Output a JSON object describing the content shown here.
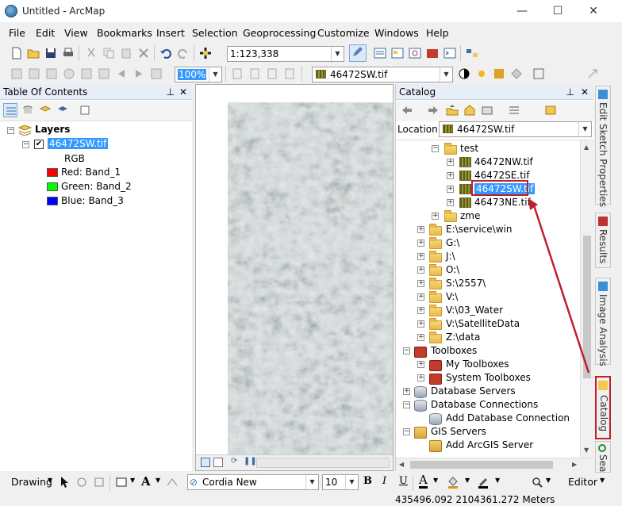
{
  "window": {
    "title": "Untitled - ArcMap",
    "minimize": "—",
    "maximize": "☐",
    "close": "✕"
  },
  "menubar": [
    "File",
    "Edit",
    "View",
    "Bookmarks",
    "Insert",
    "Selection",
    "Geoprocessing",
    "Customize",
    "Windows",
    "Help"
  ],
  "toolbar": {
    "scale": "1:123,338",
    "zoom": "100%",
    "layer_select": "46472SW.tif"
  },
  "toc": {
    "title": "Table Of Contents",
    "layers_label": "Layers",
    "layer_name": "46472SW.tif",
    "rgb_label": "RGB",
    "bands": [
      {
        "label": "Red:",
        "band": "Band_1",
        "color": "#ff0000"
      },
      {
        "label": "Green:",
        "band": "Band_2",
        "color": "#00ff00"
      },
      {
        "label": "Blue:",
        "band": "Band_3",
        "color": "#0000ff"
      }
    ]
  },
  "catalog": {
    "title": "Catalog",
    "location_label": "Location:",
    "location_value": "46472SW.tif",
    "tree": {
      "test_folder": "test",
      "test_files": [
        "46472NW.tif",
        "46472SE.tif",
        "46472SW.tif",
        "46473NE.tif"
      ],
      "zme_folder": "zme",
      "drives": [
        "E:\\service\\win",
        "G:\\",
        "J:\\",
        "O:\\",
        "S:\\2557\\",
        "V:\\",
        "V:\\03_Water",
        "V:\\SatelliteData",
        "Z:\\data"
      ],
      "toolboxes": "Toolboxes",
      "my_toolboxes": "My Toolboxes",
      "system_toolboxes": "System Toolboxes",
      "database_servers": "Database Servers",
      "database_connections": "Database Connections",
      "add_database_connection": "Add Database Connection",
      "gis_servers": "GIS Servers",
      "add_arcgis_server": "Add ArcGIS Server"
    }
  },
  "side_tabs": {
    "edit_sketch": "Edit Sketch Properties",
    "results": "Results",
    "image_analysis": "Image Analysis",
    "catalog": "Catalog",
    "search": "Sea"
  },
  "drawing_toolbar": {
    "drawing": "Drawing",
    "font": "Cordia New",
    "size": "10",
    "bold": "B",
    "italic": "I",
    "underline": "U",
    "editor": "Editor"
  },
  "status": {
    "coords": "435496.092  2104361.272 Meters"
  },
  "colors": {
    "highlight": "#3399ff",
    "annotation_red": "#c0202a"
  }
}
